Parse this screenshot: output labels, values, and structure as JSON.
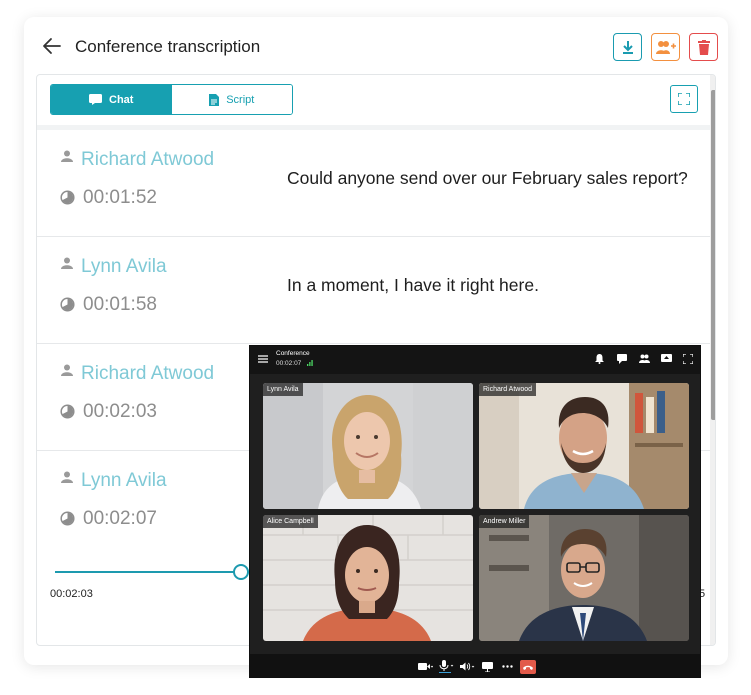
{
  "header": {
    "title": "Conference transcription",
    "buttons": [
      "download-icon",
      "add-user-icon",
      "trash-icon"
    ]
  },
  "tabs": [
    {
      "label": "Chat",
      "active": true,
      "icon": "chat-icon"
    },
    {
      "label": "Script",
      "active": false,
      "icon": "document-icon"
    }
  ],
  "transcript": [
    {
      "speaker": "Richard Atwood",
      "time": "00:01:52",
      "message": "Could anyone send over our February sales report?"
    },
    {
      "speaker": "Lynn Avila",
      "time": "00:01:58",
      "message": "In a moment, I have it right here."
    },
    {
      "speaker": "Richard Atwood",
      "time": "00:02:03",
      "message": ""
    },
    {
      "speaker": "Lynn Avila",
      "time": "00:02:07",
      "message": ""
    }
  ],
  "player": {
    "current_time": "00:02:03",
    "end_time_fragment": "5",
    "progress": 0.29
  },
  "conference": {
    "title": "Conference",
    "elapsed": "00:02:07",
    "participants": [
      {
        "name": "Lynn Avila"
      },
      {
        "name": "Richard Atwood"
      },
      {
        "name": "Alice Campbell"
      },
      {
        "name": "Andrew Miller"
      }
    ]
  },
  "colors": {
    "accent": "#17a0b1",
    "speaker": "#7fc9d6",
    "add_user": "#f3903f",
    "delete": "#e44c4c",
    "hangup": "#e25a4a"
  }
}
